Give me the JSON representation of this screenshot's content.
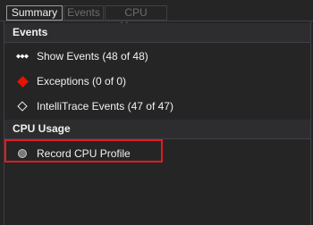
{
  "tabs": [
    {
      "label": "Summary",
      "active": true
    },
    {
      "label": "Events",
      "active": false
    },
    {
      "label": "CPU Usage",
      "active": false
    }
  ],
  "events_section": {
    "title": "Events",
    "items": [
      {
        "label": "Show Events (48 of 48)",
        "icon": "events-icon"
      },
      {
        "label": "Exceptions (0 of 0)",
        "icon": "red-diamond-icon"
      },
      {
        "label": "IntelliTrace Events (47 of 47)",
        "icon": "outline-diamond-icon"
      }
    ]
  },
  "cpu_section": {
    "title": "CPU Usage",
    "items": [
      {
        "label": "Record CPU Profile",
        "icon": "record-circle-icon",
        "highlighted": true
      }
    ]
  },
  "colors": {
    "background": "#252526",
    "exception_red": "#e51400",
    "highlight_border": "#e31b23"
  }
}
